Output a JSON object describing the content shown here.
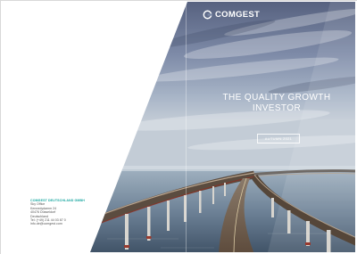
{
  "brand": {
    "logo_text": "COMGEST",
    "accent_color": "#1aa7a1",
    "logo_icon": "comgest-logo-icon"
  },
  "cover": {
    "headline_line1": "THE QUALITY GROWTH",
    "headline_line2": "INVESTOR",
    "edition_label": "AUTUMN 2021"
  },
  "back": {
    "contact": {
      "company": "COMGEST DEUTSCHLAND GMBH",
      "office": "Sky Office",
      "street": "Kennedydamm 24",
      "city": "40476 Düsseldorf",
      "country": "Deutschland",
      "phone": "Tel: (+49) 211 44 03 87 0",
      "email": "info.de@comgest.com"
    }
  }
}
